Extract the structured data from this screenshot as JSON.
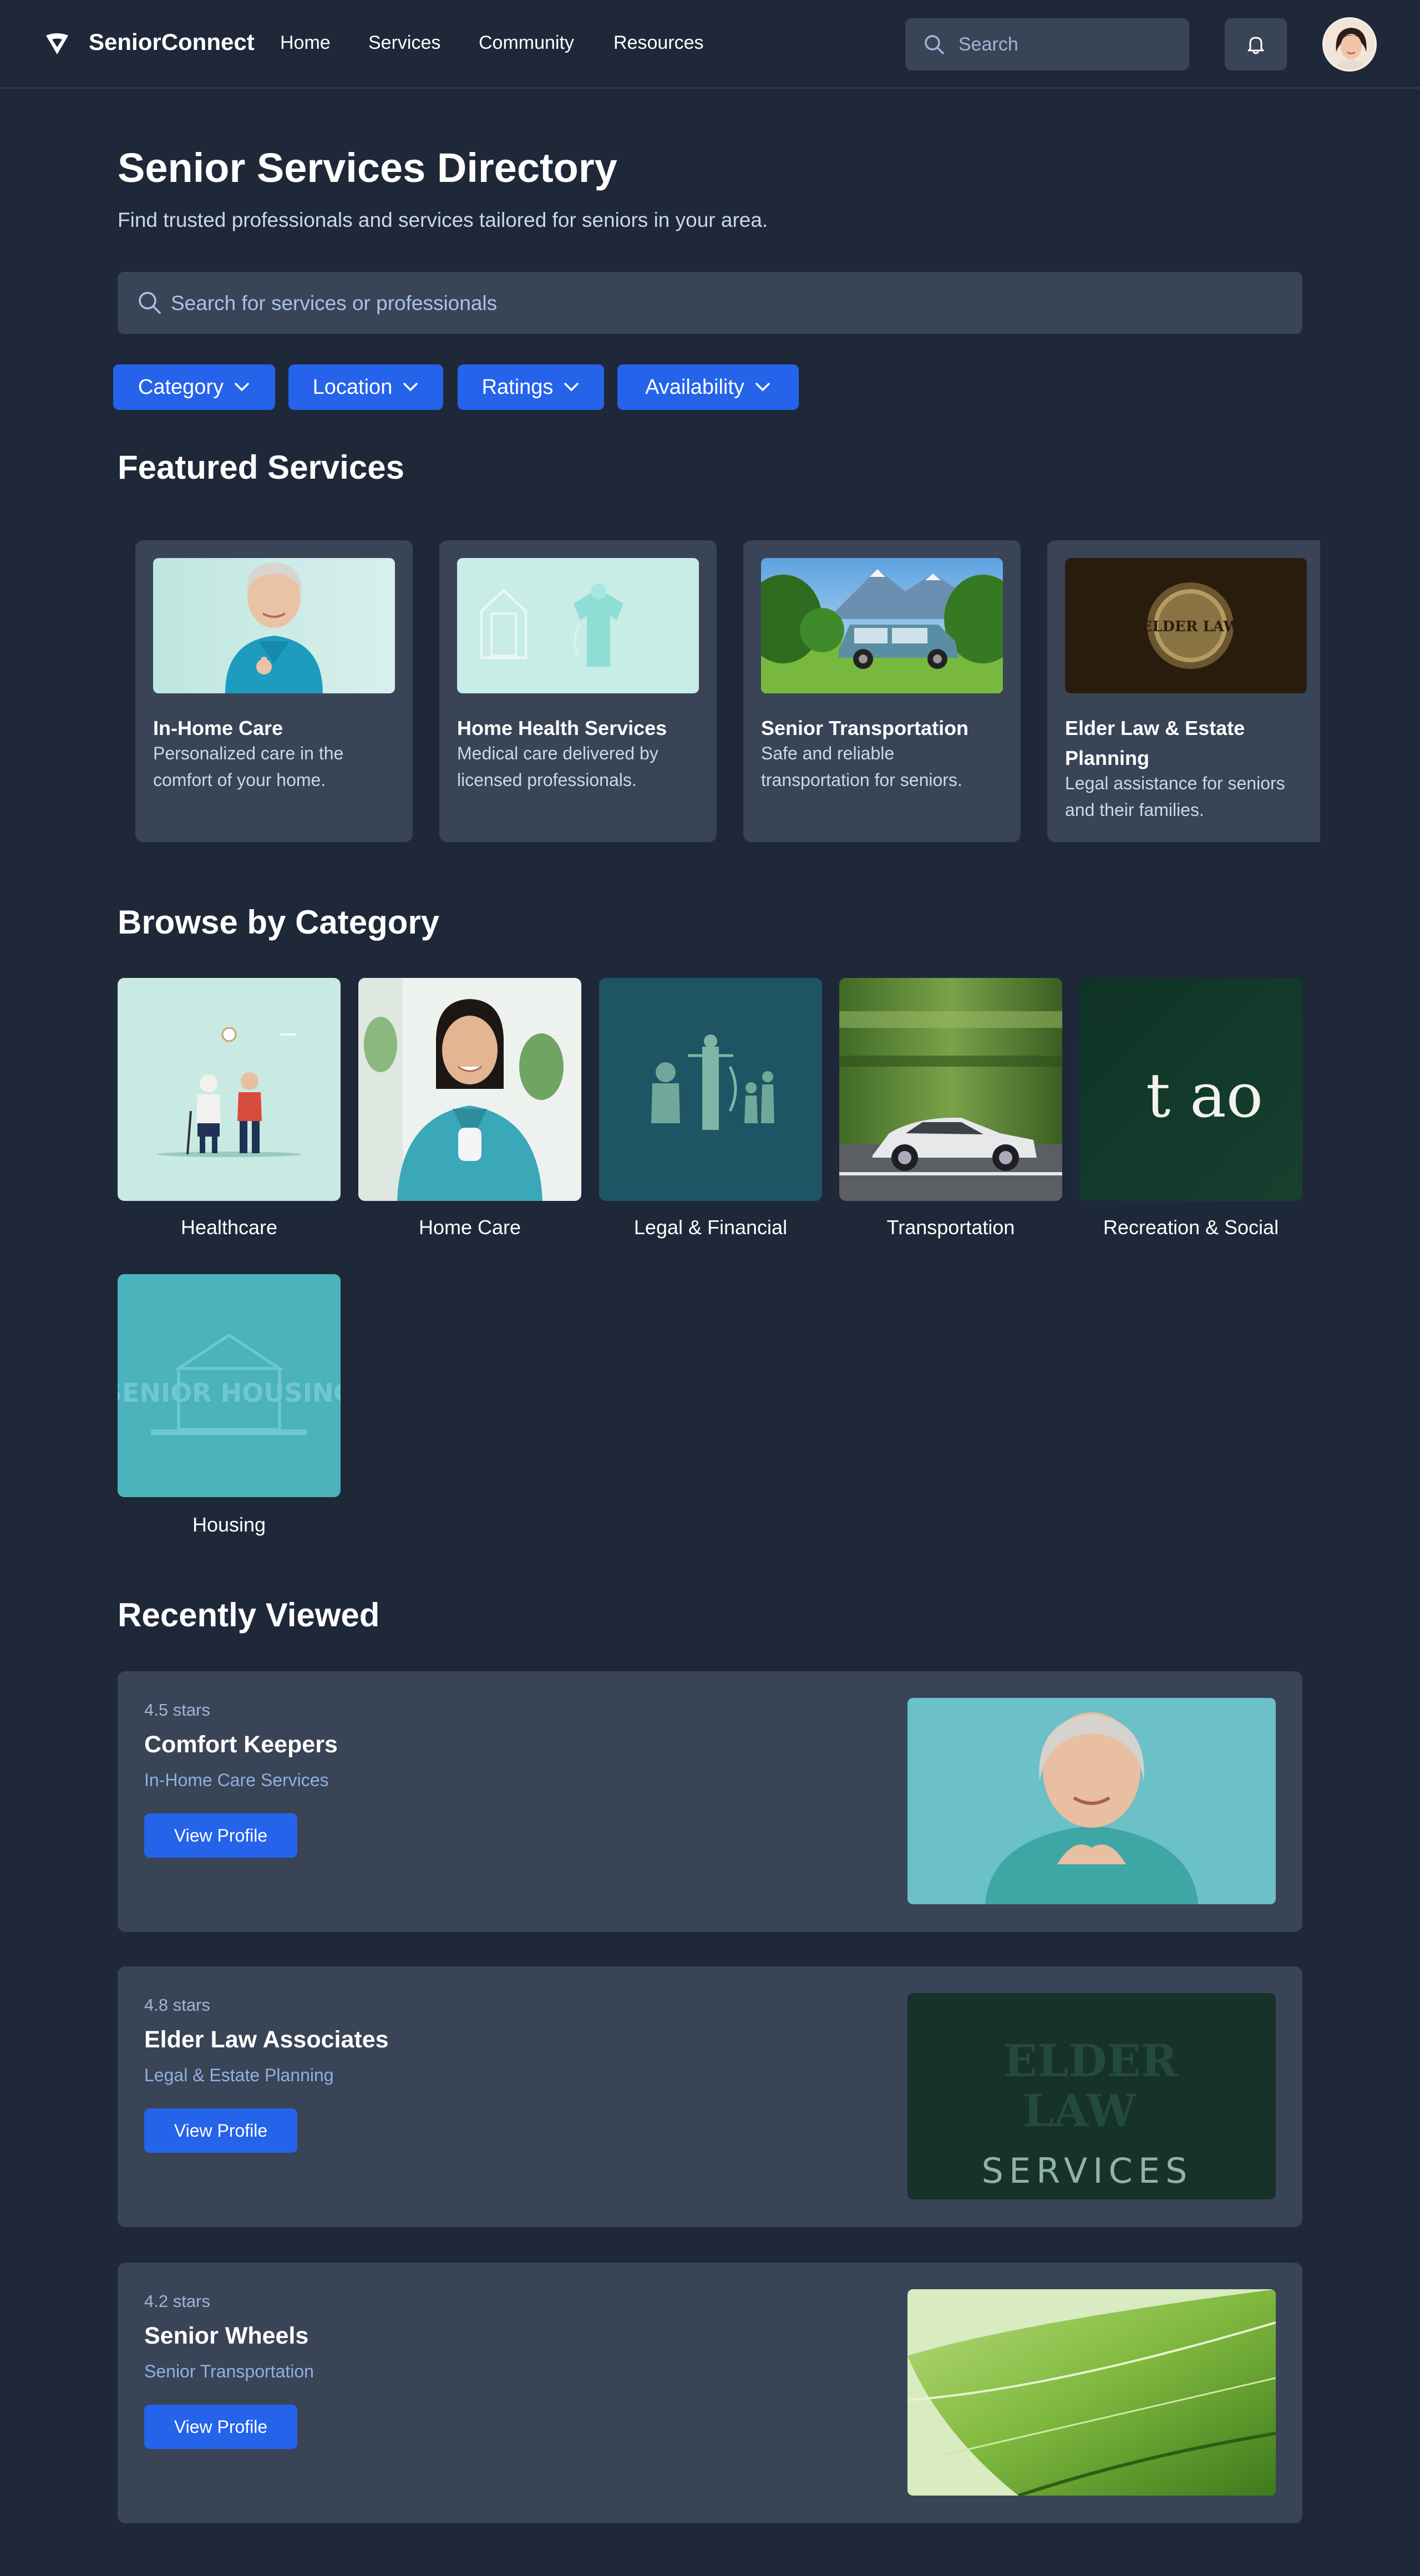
{
  "app": {
    "brand": "SeniorConnect",
    "nav": [
      "Home",
      "Services",
      "Community",
      "Resources"
    ],
    "search_placeholder": "Search"
  },
  "hero": {
    "title": "Senior Services Directory",
    "subtitle": "Find trusted professionals and services tailored for seniors in your area.",
    "search_placeholder": "Search for services or professionals"
  },
  "filters": [
    "Category",
    "Location",
    "Ratings",
    "Availability"
  ],
  "featured": {
    "heading": "Featured Services",
    "items": [
      {
        "title": "In-Home Care",
        "desc": "Personalized care in the comfort of your home."
      },
      {
        "title": "Home Health Services",
        "desc": "Medical care delivered by licensed professionals."
      },
      {
        "title": "Senior Transportation",
        "desc": "Safe and reliable transportation for seniors."
      },
      {
        "title": "Elder Law & Estate Planning",
        "desc": "Legal assistance for seniors and their families."
      }
    ]
  },
  "categories": {
    "heading": "Browse by Category",
    "items": [
      "Healthcare",
      "Home Care",
      "Legal & Financial",
      "Transportation",
      "Recreation & Social",
      "Housing"
    ]
  },
  "recent": {
    "heading": "Recently Viewed",
    "button_label": "View Profile",
    "items": [
      {
        "rating": "4.5 stars",
        "name": "Comfort Keepers",
        "category": "In-Home Care Services"
      },
      {
        "rating": "4.8 stars",
        "name": "Elder Law Associates",
        "category": "Legal & Estate Planning"
      },
      {
        "rating": "4.2 stars",
        "name": "Senior Wheels",
        "category": "Senior Transportation"
      }
    ]
  },
  "image_text": {
    "elder_law_seal": "ELDER LAW",
    "recreation_letters": "t ao",
    "housing_sign": "SENIOR HOUSING",
    "elder_services": [
      "ELDER",
      "LAW",
      "SERVICES"
    ]
  },
  "colors": {
    "background": "#1f2838",
    "card": "#3a4457",
    "accent": "#2563eb",
    "muted_text": "#c9d8ee"
  }
}
